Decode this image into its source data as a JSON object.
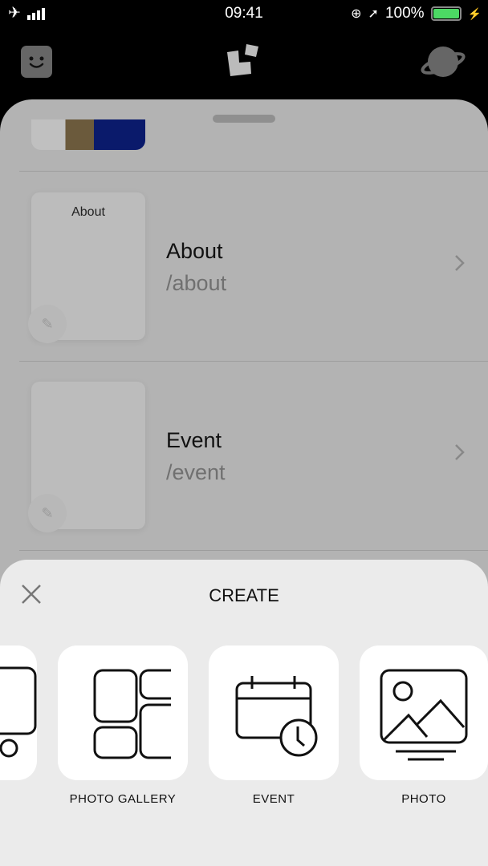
{
  "status_bar": {
    "time": "09:41",
    "battery": "100%",
    "battery_level": 1.0,
    "battery_color": "#4cd964"
  },
  "pages": [
    {
      "thumb_label": "About",
      "title": "About",
      "path": "/about"
    },
    {
      "thumb_label": "",
      "title": "Event",
      "path": "/event"
    }
  ],
  "create_sheet": {
    "title": "CREATE",
    "items": [
      {
        "label": "",
        "icon": "phone-icon"
      },
      {
        "label": "PHOTO GALLERY",
        "icon": "gallery-icon"
      },
      {
        "label": "EVENT",
        "icon": "calendar-clock-icon"
      },
      {
        "label": "PHOTO",
        "icon": "image-icon"
      }
    ]
  }
}
